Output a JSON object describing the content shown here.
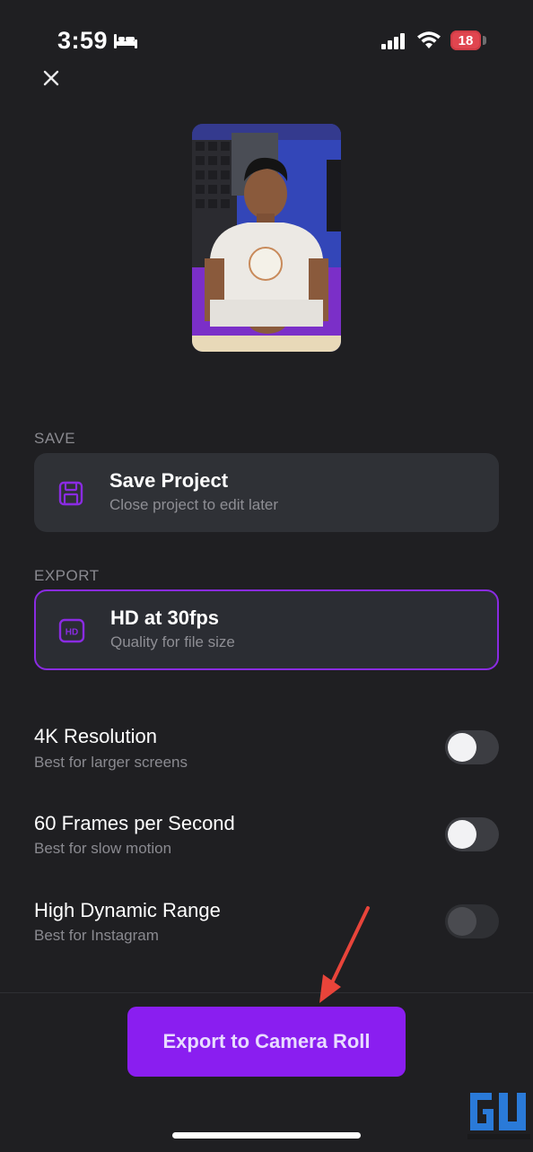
{
  "status_bar": {
    "time": "3:59",
    "battery_level": "18",
    "icons": [
      "bed-icon",
      "signal-icon",
      "wifi-icon",
      "battery-icon"
    ]
  },
  "header": {
    "close_icon": "close-icon"
  },
  "save_section": {
    "label": "SAVE",
    "card": {
      "icon": "save-icon",
      "title": "Save Project",
      "subtitle": "Close project to edit later"
    }
  },
  "export_section": {
    "label": "EXPORT",
    "card": {
      "icon": "hd-icon",
      "icon_text": "HD",
      "title": "HD at 30fps",
      "subtitle": "Quality for file size",
      "selected": true
    }
  },
  "options": [
    {
      "title": "4K Resolution",
      "subtitle": "Best for larger screens",
      "enabled": false,
      "available": true
    },
    {
      "title": "60 Frames per Second",
      "subtitle": "Best for slow motion",
      "enabled": false,
      "available": true
    },
    {
      "title": "High Dynamic Range",
      "subtitle": "Best for Instagram",
      "enabled": false,
      "available": false
    }
  ],
  "export_button": {
    "label": "Export to Camera Roll"
  },
  "colors": {
    "background": "#1f1f22",
    "card": "#2f3136",
    "accent": "#8a1ef0",
    "accent_border": "#8a2be2",
    "annotation_arrow": "#e8443a"
  }
}
